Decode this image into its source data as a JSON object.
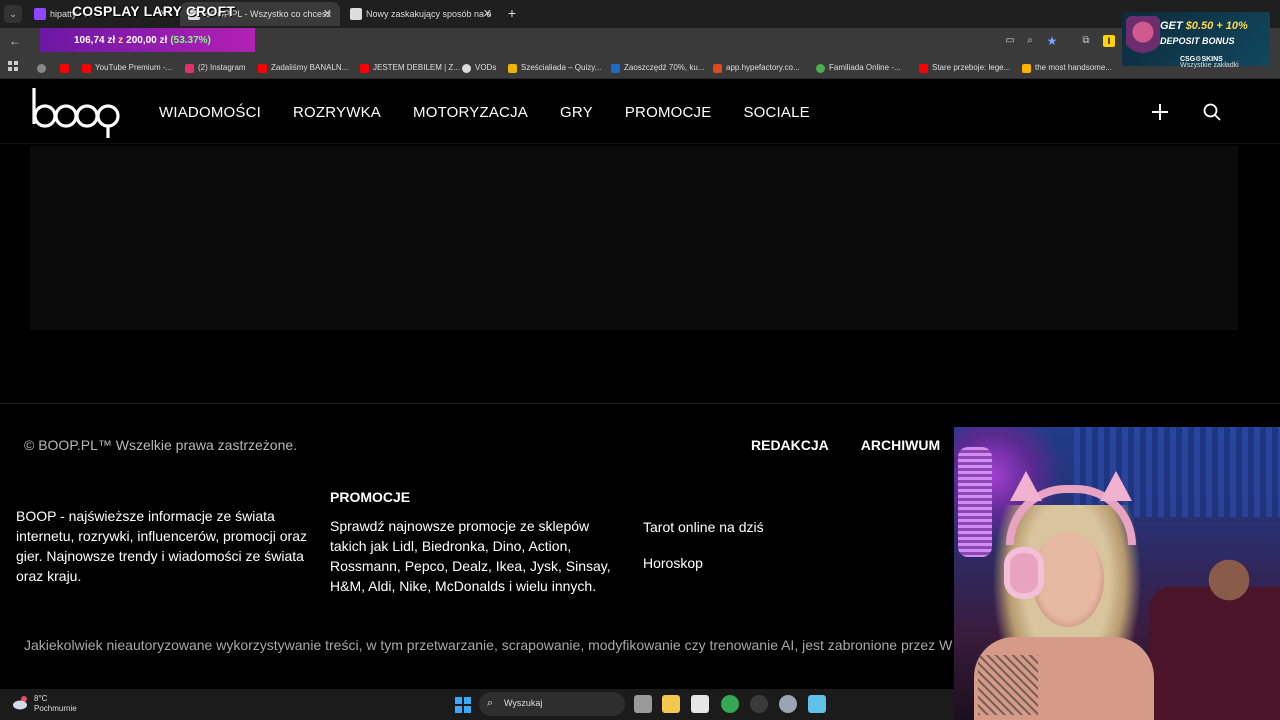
{
  "browser": {
    "tabs": [
      {
        "title": "hipatty - ...",
        "favicon_color": "#9146ff",
        "active": false
      },
      {
        "title": "BOOP.PL - Wszystko co chcesz",
        "favicon_color": "#cccccc",
        "active": true
      },
      {
        "title": "Nowy zaskakujący sposób na o",
        "favicon_color": "#cccccc",
        "active": false
      }
    ],
    "bookmarks": [
      {
        "label": "YouTube Premium -...",
        "icon_color": "#ff0000"
      },
      {
        "label": "(2) Instagram",
        "icon_color": "#e1306c"
      },
      {
        "label": "Zadaliśmy BANALN...",
        "icon_color": "#ff0000"
      },
      {
        "label": "JESTEM DEBILEM | Z...",
        "icon_color": "#ff0000"
      },
      {
        "label": "VODs",
        "icon_color": "#dddddd"
      },
      {
        "label": "Sześcialiada – Quizy...",
        "icon_color": "#f0b400"
      },
      {
        "label": "Zaoszczędź 70%, ku...",
        "icon_color": "#1b6ac9"
      },
      {
        "label": "app.hypefactory.co...",
        "icon_color": "#e04a1b"
      },
      {
        "label": "Familiada Online -...",
        "icon_color": "#4caf50"
      },
      {
        "label": "Stare przeboje: lege...",
        "icon_color": "#ff0000"
      },
      {
        "label": "the most handsome...",
        "icon_color": "#ffb300"
      },
      {
        "label": "Wszystkie zakładki",
        "icon_color": "#dddddd"
      }
    ]
  },
  "stream_overlay": {
    "title": "COSPLAY LARY CROFT",
    "goal_current": "106,74 zł",
    "goal_sep": "z",
    "goal_target": "200,00 zł",
    "goal_percent": "(53.37%)",
    "goal_progress": 0.5337
  },
  "ad_banner": {
    "line1_prefix": "GET",
    "line1_highlight": "$0.50 + 10%",
    "line2": "DEPOSIT BONUS",
    "brand": "CSG⚙SKINS"
  },
  "site": {
    "logo_text": "boop",
    "nav": [
      "WIADOMOŚCI",
      "ROZRYWKA",
      "MOTORYZACJA",
      "GRY",
      "PROMOCJE",
      "SOCIALE"
    ],
    "footer": {
      "copyright": "© BOOP.PL™ Wszelkie prawa zastrzeżone.",
      "links": [
        "REDAKCJA",
        "ARCHIWUM"
      ],
      "about": "BOOP - najświeższe informacje ze świata internetu, rozrywki, influencerów, promocji oraz gier. Najnowsze trendy i wiadomości ze świata oraz kraju.",
      "promo_heading": "PROMOCJE",
      "promo_text": "Sprawdź najnowsze promocje ze sklepów takich jak Lidl, Biedronka, Dino, Action, Rossmann, Pepco, Dealz, Ikea, Jysk, Sinsay, H&M, Aldi, Nike, McDonalds i wielu innych.",
      "tarot": "Tarot online na dziś",
      "horoskop": "Horoskop",
      "disclaimer": "Jakiekolwiek nieautoryzowane wykorzystywanie treści, w tym przetwarzanie, scrapowanie, modyfikowanie czy trenowanie AI, jest zabronione przez W"
    }
  },
  "taskbar": {
    "temperature": "8°C",
    "weather": "Pochmurnie",
    "search_placeholder": "Wyszukaj",
    "apps": [
      {
        "name": "task-view",
        "color": "#9a9a9a"
      },
      {
        "name": "file-explorer",
        "color": "#f2c94c"
      },
      {
        "name": "ms-store",
        "color": "#e6e6e6"
      },
      {
        "name": "chrome",
        "color": "#34a853"
      },
      {
        "name": "obs",
        "color": "#3a3a3a"
      },
      {
        "name": "settings",
        "color": "#9aa4b2"
      },
      {
        "name": "streamlabs",
        "color": "#60c0e8"
      }
    ]
  }
}
